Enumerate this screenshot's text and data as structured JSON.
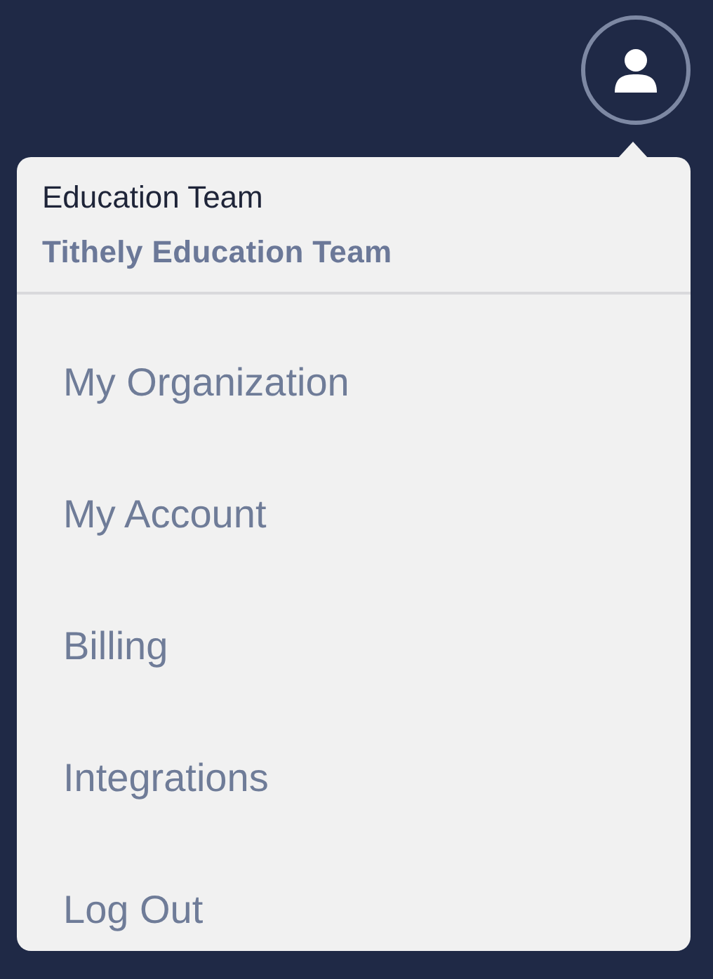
{
  "account": {
    "name": "Education Team",
    "organization": "Tithely Education Team"
  },
  "menu": {
    "items": [
      {
        "label": "My Organization"
      },
      {
        "label": "My Account"
      },
      {
        "label": "Billing"
      },
      {
        "label": "Integrations"
      },
      {
        "label": "Log Out"
      }
    ]
  }
}
